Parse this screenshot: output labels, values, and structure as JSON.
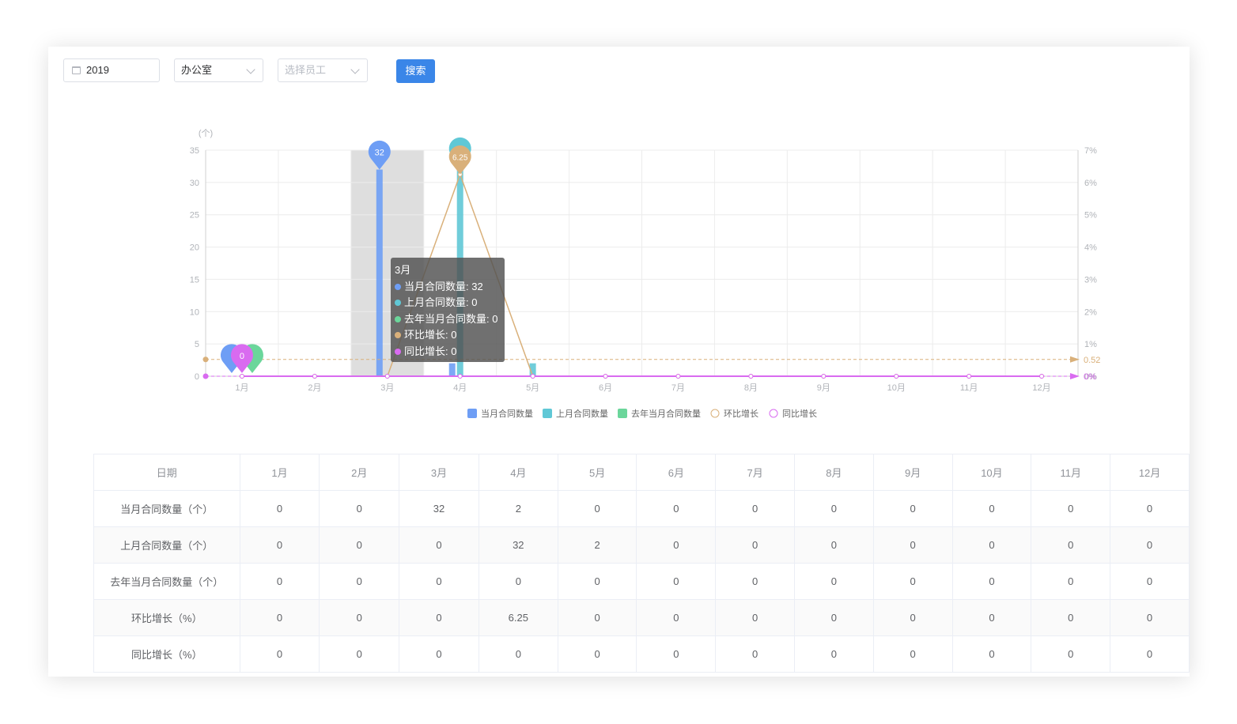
{
  "filters": {
    "year": "2019",
    "department": "办公室",
    "employee_placeholder": "选择员工",
    "search_label": "搜索"
  },
  "colors": {
    "current_month": "#6e9ef5",
    "last_month": "#60c8d6",
    "last_year": "#6bd69b",
    "mom_growth": "#d9b07a",
    "yoy_growth": "#d96bf0",
    "highlight": "#dcdcdc"
  },
  "chart_data": {
    "type": "bar",
    "categories": [
      "1月",
      "2月",
      "3月",
      "4月",
      "5月",
      "6月",
      "7月",
      "8月",
      "9月",
      "10月",
      "11月",
      "12月"
    ],
    "y_unit_label": "(个)",
    "ylim": [
      0,
      35
    ],
    "y_ticks": [
      "0",
      "5",
      "10",
      "15",
      "20",
      "25",
      "30",
      "35"
    ],
    "y2lim": [
      0,
      7
    ],
    "y2_ticks": [
      "0%",
      "1%",
      "2%",
      "3%",
      "4%",
      "5%",
      "6%",
      "7%"
    ],
    "grid": true,
    "legend_position": "bottom",
    "series": [
      {
        "name": "当月合同数量",
        "kind": "bar",
        "values": [
          0,
          0,
          32,
          2,
          0,
          0,
          0,
          0,
          0,
          0,
          0,
          0
        ]
      },
      {
        "name": "上月合同数量",
        "kind": "bar",
        "values": [
          0,
          0,
          0,
          32,
          2,
          0,
          0,
          0,
          0,
          0,
          0,
          0
        ]
      },
      {
        "name": "去年当月合同数量",
        "kind": "bar",
        "values": [
          0,
          0,
          0,
          0,
          0,
          0,
          0,
          0,
          0,
          0,
          0,
          0
        ]
      },
      {
        "name": "环比增长",
        "kind": "line",
        "axis": "right",
        "values": [
          0,
          0,
          0,
          6.25,
          0,
          0,
          0,
          0,
          0,
          0,
          0,
          0
        ]
      },
      {
        "name": "同比增长",
        "kind": "line",
        "axis": "right",
        "values": [
          0,
          0,
          0,
          0,
          0,
          0,
          0,
          0,
          0,
          0,
          0,
          0
        ]
      }
    ],
    "pins": [
      {
        "series": "当月合同数量",
        "label": "32"
      },
      {
        "series": "环比增长",
        "label": "6.25"
      },
      {
        "series": "同比增长",
        "label": "0"
      }
    ],
    "average_lines": [
      {
        "series": "环比增长",
        "label": "0.52",
        "value": 0.52
      },
      {
        "series": "同比增长",
        "label": "0%",
        "value": 0
      }
    ],
    "highlighted_category": "3月"
  },
  "tooltip": {
    "title": "3月",
    "rows": [
      {
        "text": "当月合同数量: 32",
        "color": "#6e9ef5"
      },
      {
        "text": "上月合同数量: 0",
        "color": "#60c8d6"
      },
      {
        "text": "去年当月合同数量: 0",
        "color": "#6bd69b"
      },
      {
        "text": "环比增长: 0",
        "color": "#d9b07a"
      },
      {
        "text": "同比增长: 0",
        "color": "#d96bf0"
      }
    ]
  },
  "table": {
    "header": [
      "日期",
      "1月",
      "2月",
      "3月",
      "4月",
      "5月",
      "6月",
      "7月",
      "8月",
      "9月",
      "10月",
      "11月",
      "12月"
    ],
    "rows": [
      [
        "当月合同数量（个）",
        "0",
        "0",
        "32",
        "2",
        "0",
        "0",
        "0",
        "0",
        "0",
        "0",
        "0",
        "0"
      ],
      [
        "上月合同数量（个）",
        "0",
        "0",
        "0",
        "32",
        "2",
        "0",
        "0",
        "0",
        "0",
        "0",
        "0",
        "0"
      ],
      [
        "去年当月合同数量（个）",
        "0",
        "0",
        "0",
        "0",
        "0",
        "0",
        "0",
        "0",
        "0",
        "0",
        "0",
        "0"
      ],
      [
        "环比增长（%）",
        "0",
        "0",
        "0",
        "6.25",
        "0",
        "0",
        "0",
        "0",
        "0",
        "0",
        "0",
        "0"
      ],
      [
        "同比增长（%）",
        "0",
        "0",
        "0",
        "0",
        "0",
        "0",
        "0",
        "0",
        "0",
        "0",
        "0",
        "0"
      ]
    ]
  }
}
